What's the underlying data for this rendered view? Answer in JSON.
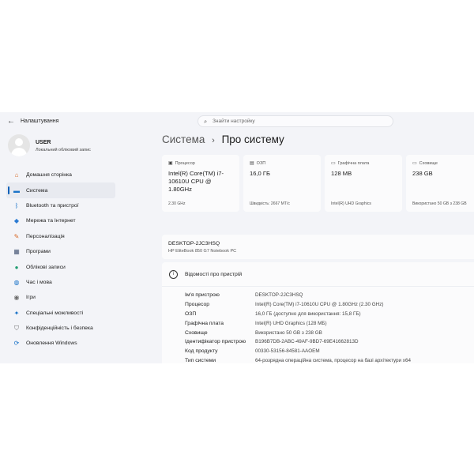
{
  "window": {
    "title": "Налаштування",
    "search_placeholder": "Знайти настройку"
  },
  "user": {
    "name": "USER",
    "account_type": "Локальний обліковий запис"
  },
  "nav": [
    {
      "label": "Домашня сторінка",
      "icon": "home-icon",
      "glyph": "⌂",
      "color": "#d86a2a"
    },
    {
      "label": "Система",
      "icon": "monitor-icon",
      "glyph": "▬",
      "color": "#1a73c8",
      "active": true
    },
    {
      "label": "Bluetooth та пристрої",
      "icon": "bluetooth-icon",
      "glyph": "ᛒ",
      "color": "#1a73c8"
    },
    {
      "label": "Мережа та Інтернет",
      "icon": "wifi-icon",
      "glyph": "◆",
      "color": "#2b7bd3"
    },
    {
      "label": "Персоналізація",
      "icon": "brush-icon",
      "glyph": "✎",
      "color": "#d86a2a"
    },
    {
      "label": "Програми",
      "icon": "apps-icon",
      "glyph": "▦",
      "color": "#4a5a78"
    },
    {
      "label": "Облікові записи",
      "icon": "account-icon",
      "glyph": "●",
      "color": "#1f9c70"
    },
    {
      "label": "Час і мова",
      "icon": "globe-icon",
      "glyph": "◍",
      "color": "#1a73c8"
    },
    {
      "label": "Ігри",
      "icon": "gamepad-icon",
      "glyph": "◉",
      "color": "#6b6b6b"
    },
    {
      "label": "Спеціальні можливості",
      "icon": "accessibility-icon",
      "glyph": "✦",
      "color": "#1a73c8"
    },
    {
      "label": "Конфіденційність і безпека",
      "icon": "shield-icon",
      "glyph": "⛉",
      "color": "#6b6b6b"
    },
    {
      "label": "Оновлення Windows",
      "icon": "update-icon",
      "glyph": "⟳",
      "color": "#1a73c8"
    }
  ],
  "breadcrumb": {
    "parent": "Система",
    "separator": "›",
    "current": "Про систему"
  },
  "specs": [
    {
      "title": "Процесор",
      "icon": "cpu-icon",
      "glyph": "▣",
      "value": "Intel(R) Core(TM) i7-10610U CPU @ 1.80GHz",
      "footer": "2.30 GHz"
    },
    {
      "title": "ОЗП",
      "icon": "ram-icon",
      "glyph": "▤",
      "value": "16,0 ГБ",
      "footer": "Швидкість: 2667 МТ/с"
    },
    {
      "title": "Графічна плата",
      "icon": "gpu-icon",
      "glyph": "▭",
      "value": "128 MB",
      "footer": "Intel(R) UHD Graphics"
    },
    {
      "title": "Сховище",
      "icon": "storage-icon",
      "glyph": "▭",
      "value": "238 GB",
      "footer": "Використано 50 GB з 238 GB"
    }
  ],
  "device": {
    "name": "DESKTOP-2JC3HSQ",
    "model": "HP EliteBook 850 G7 Notebook PC"
  },
  "device_specs": {
    "title": "Відомості про пристрій",
    "rows": [
      {
        "key": "Ім'я пристрою",
        "value": "DESKTOP-2JC3HSQ"
      },
      {
        "key": "Процесор",
        "value": "Intel(R) Core(TM) i7-10610U CPU @ 1.80GHz (2.30 GHz)"
      },
      {
        "key": "ОЗП",
        "value": "16,0 ГБ (доступно для використання: 15,8 ГБ)"
      },
      {
        "key": "Графічна плата",
        "value": "Intel(R) UHD Graphics (128 МБ)"
      },
      {
        "key": "Сховище",
        "value": "Використано 50 GB з 238 GB"
      },
      {
        "key": "Ідентифікатор пристрою",
        "value": "B196B7DB-2ABC-49AF-9BD7-69E41662813D"
      },
      {
        "key": "Код продукту",
        "value": "00330-53156-84581-AAOEM"
      },
      {
        "key": "Тип системи",
        "value": "64-розрядна операційна система, процесор на базі архітектури x64"
      }
    ]
  }
}
